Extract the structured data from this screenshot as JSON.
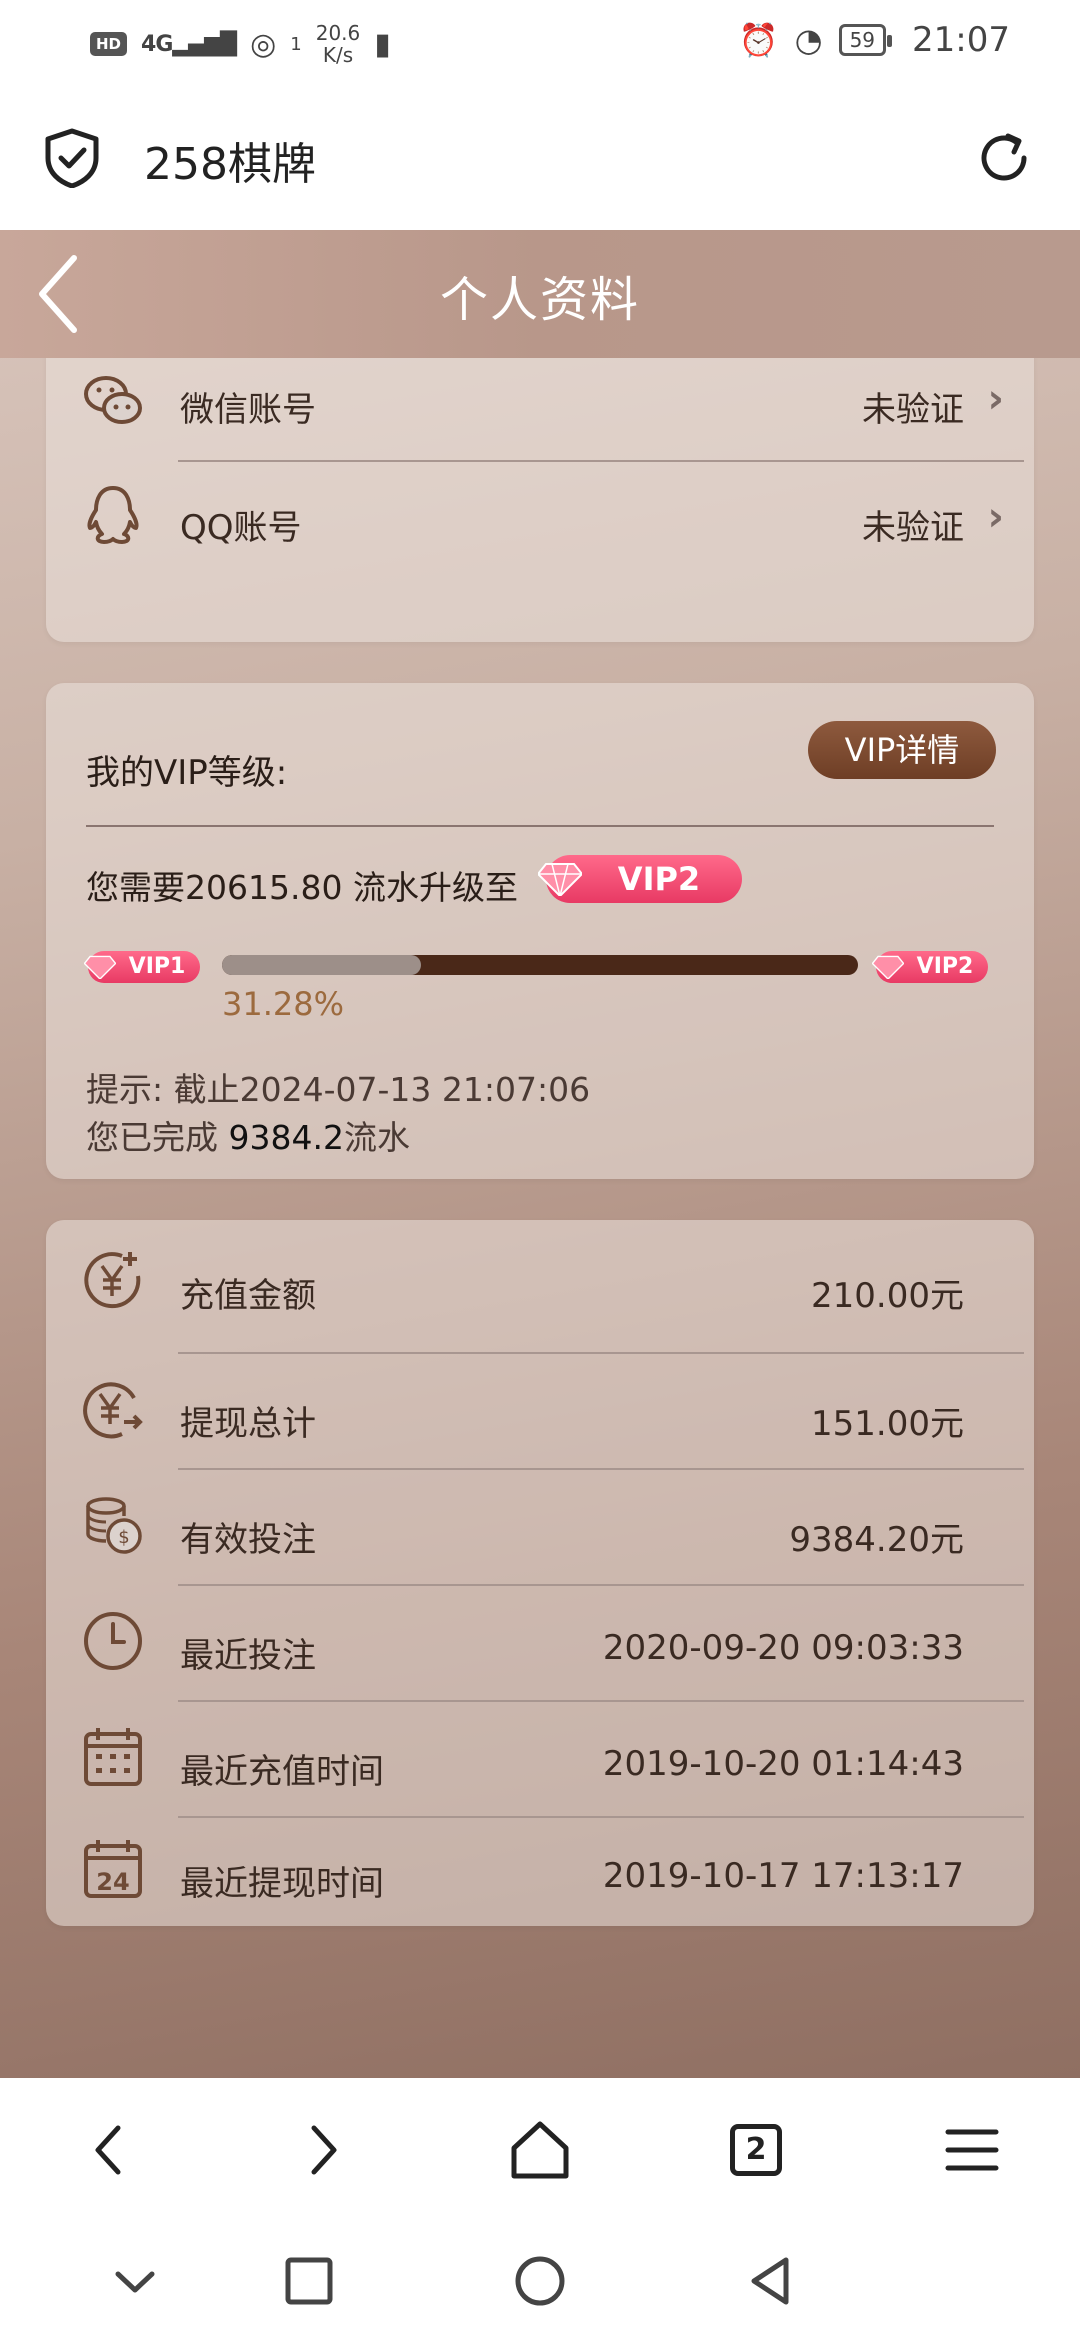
{
  "status_bar": {
    "hd": "HD",
    "network": "4G",
    "speed_value": "20.6",
    "speed_unit": "K/s",
    "sim": "1",
    "battery": "59",
    "time": "21:07"
  },
  "browser": {
    "title": "258棋牌",
    "tab_count": "2"
  },
  "header": {
    "title": "个人资料"
  },
  "account_rows": [
    {
      "label": "微信账号",
      "value": "未验证",
      "icon": "wechat-icon"
    },
    {
      "label": "QQ账号",
      "value": "未验证",
      "icon": "qq-icon"
    }
  ],
  "vip": {
    "label": "我的VIP等级:",
    "detail_button": "VIP详情",
    "need_text": "您需要20615.80 流水升级至",
    "target_badge": "VIP2",
    "current_badge": "VIP1",
    "next_badge": "VIP2",
    "progress": 0.3128,
    "progress_text": "31.28%",
    "tip_line1": "提示:  截止2024-07-13 21:07:06",
    "tip_prefix": "您已完成 ",
    "tip_amount": "9384.2",
    "tip_suffix": "流水"
  },
  "stats": [
    {
      "label": "充值金额",
      "value": "210.00元",
      "icon": "yuan-plus-icon"
    },
    {
      "label": "提现总计",
      "value": "151.00元",
      "icon": "yuan-withdraw-icon"
    },
    {
      "label": "有效投注",
      "value": "9384.20元",
      "icon": "coins-icon"
    },
    {
      "label": "最近投注",
      "value": "2020-09-20 09:03:33",
      "icon": "clock-icon"
    },
    {
      "label": "最近充值时间",
      "value": "2019-10-20 01:14:43",
      "icon": "calendar-icon"
    },
    {
      "label": "最近提现时间",
      "value": "2019-10-17 17:13:17",
      "icon": "calendar-24-icon"
    }
  ],
  "colors": {
    "accent": "#6e3e25",
    "vip_pink": "#e83a64",
    "progress_track": "#4a2818"
  }
}
